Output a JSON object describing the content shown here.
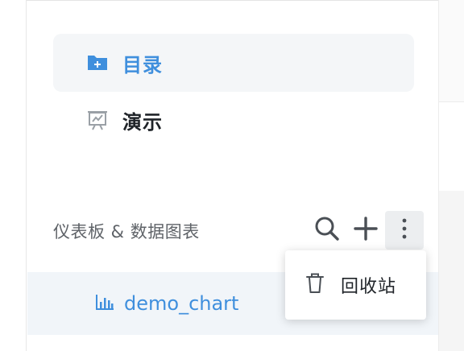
{
  "nav": {
    "items": [
      {
        "label": "目录",
        "icon": "folder-plus-icon",
        "active": true
      },
      {
        "label": "演示",
        "icon": "presentation-icon",
        "active": false
      }
    ]
  },
  "section": {
    "title": "仪表板 & 数据图表",
    "actions": [
      "search-icon",
      "plus-icon",
      "more-vertical-icon"
    ]
  },
  "tree": {
    "items": [
      {
        "label": "demo_chart",
        "icon": "bar-chart-icon"
      }
    ]
  },
  "dropdown": {
    "items": [
      {
        "label": "回收站",
        "icon": "trash-icon"
      }
    ]
  },
  "colors": {
    "accent": "#3f8fdd",
    "text_dark": "#1f2328",
    "text_muted": "#5f6368",
    "active_bg": "#f4f6f8",
    "row_bg": "#f1f5f9"
  }
}
